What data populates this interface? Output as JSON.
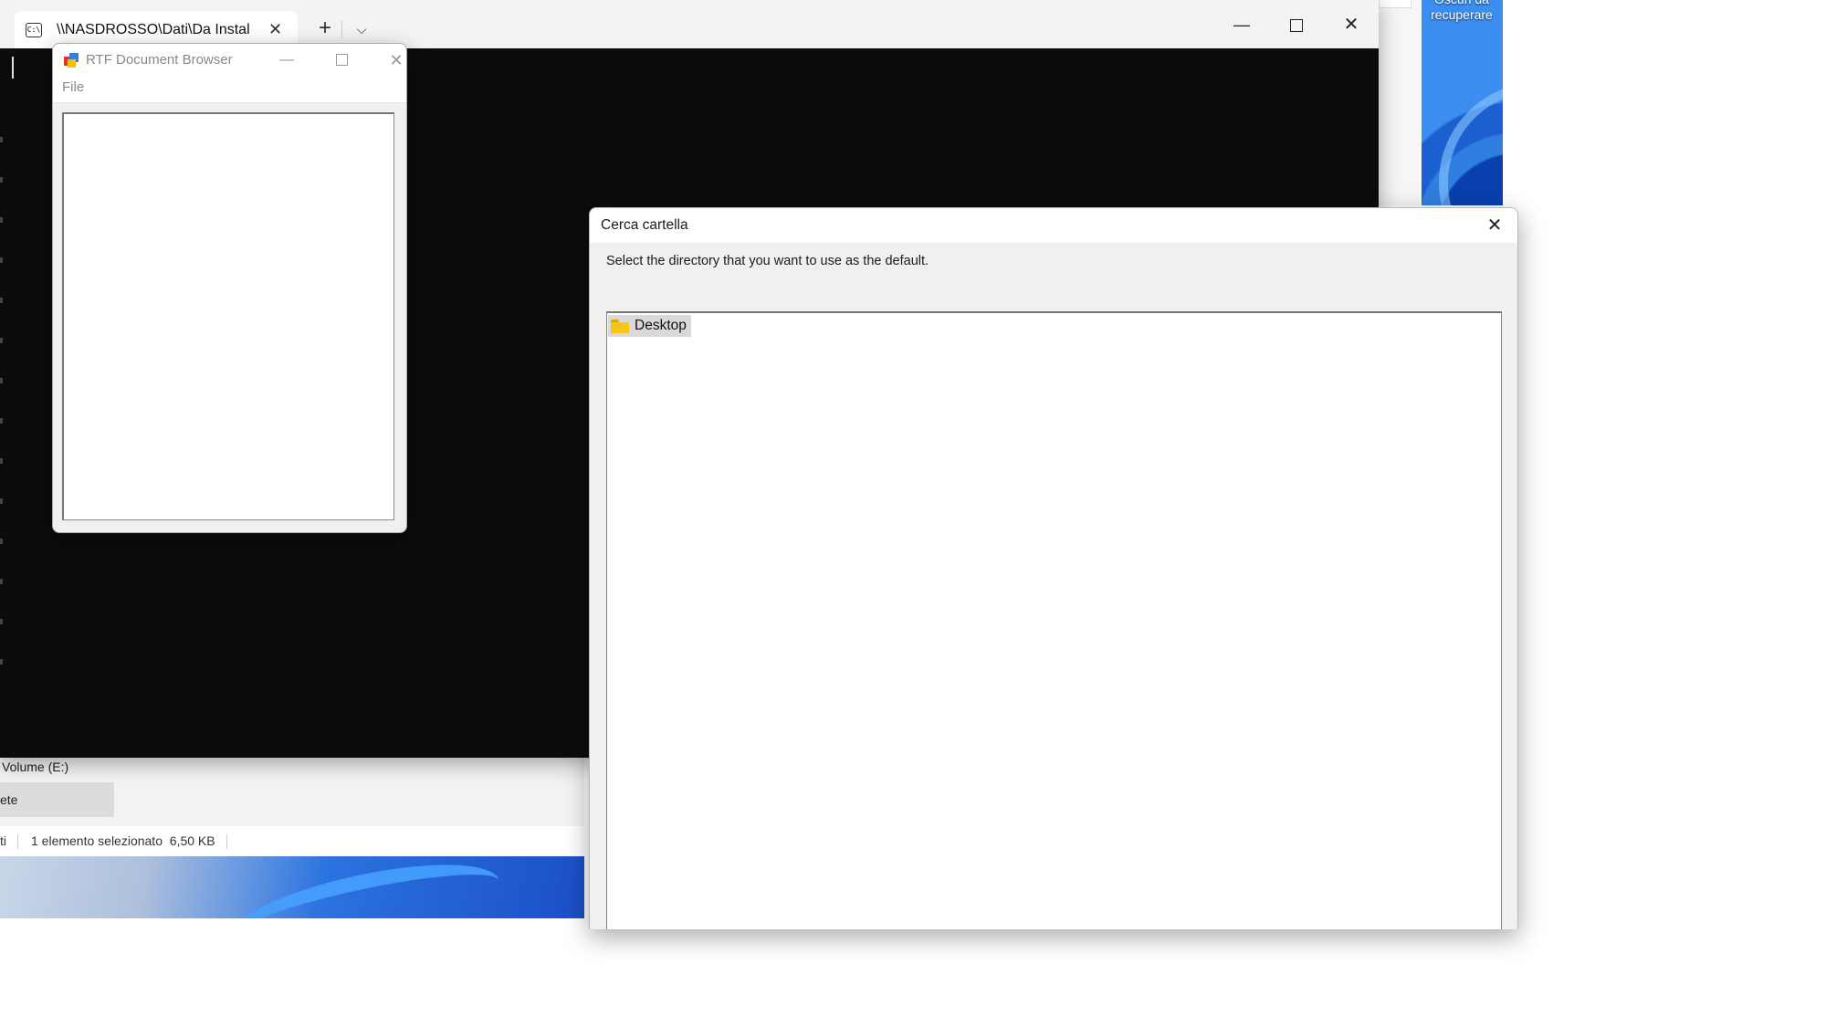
{
  "desktop": {
    "icon_label_line1": "Oscuri da",
    "icon_label_line2": "recuperare"
  },
  "explorer": {
    "drive_item": "Volume (E:)",
    "network_item": "ete",
    "status_left": "ti",
    "status_selection": "1 elemento selezionato",
    "status_size": "6,50 KB"
  },
  "terminal": {
    "tab_title": "\\\\NASDROSSO\\Dati\\Da Instal",
    "tab_icon_text": "C:\\",
    "new_tab_glyph": "+",
    "dropdown_glyph": "⌵",
    "minimize_glyph": "—",
    "close_glyph": "✕",
    "tab_close_glyph": "✕"
  },
  "rtf_browser": {
    "title": "RTF Document Browser",
    "menu": [
      "File"
    ],
    "minimize_glyph": "—",
    "close_glyph": "✕"
  },
  "folder_dialog": {
    "title": "Cerca cartella",
    "instruction": "Select the directory that you want to use as the default.",
    "tree_items": [
      {
        "label": "Desktop",
        "icon": "folder-icon",
        "selected": true
      }
    ],
    "close_glyph": "✕"
  }
}
